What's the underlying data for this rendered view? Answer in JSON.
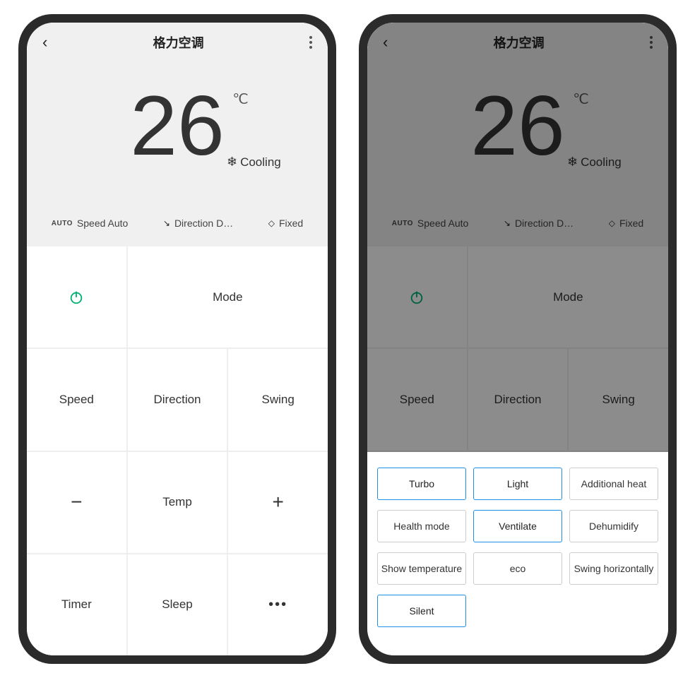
{
  "header": {
    "title": "格力空调"
  },
  "hero": {
    "temperature": "26",
    "unit": "℃",
    "mode_label": "Cooling"
  },
  "status": {
    "speed_label": "Speed Auto",
    "direction_label": "Direction D…",
    "swing_label": "Fixed"
  },
  "controls": {
    "mode": "Mode",
    "speed": "Speed",
    "direction": "Direction",
    "swing": "Swing",
    "temp": "Temp",
    "timer": "Timer",
    "sleep": "Sleep"
  },
  "sheet": {
    "options": [
      {
        "label": "Turbo",
        "active": true
      },
      {
        "label": "Light",
        "active": true
      },
      {
        "label": "Additional heat",
        "active": false
      },
      {
        "label": "Health mode",
        "active": false
      },
      {
        "label": "Ventilate",
        "active": true
      },
      {
        "label": "Dehumidify",
        "active": false
      },
      {
        "label": "Show temperature",
        "active": false
      },
      {
        "label": "eco",
        "active": false
      },
      {
        "label": "Swing horizontally",
        "active": false
      },
      {
        "label": "Silent",
        "active": true
      }
    ]
  }
}
